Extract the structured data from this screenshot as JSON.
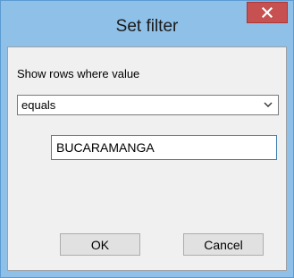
{
  "window": {
    "title": "Set filter",
    "close_icon": "close-x-icon"
  },
  "filter": {
    "prompt": "Show rows where value",
    "operator": {
      "selected": "equals",
      "icon": "chevron-down-icon"
    },
    "value": "BUCARAMANGA"
  },
  "buttons": {
    "ok": "OK",
    "cancel": "Cancel"
  },
  "colors": {
    "titlebar": "#8ec0e8",
    "close_button": "#c75050",
    "client_bg": "#f0f0f0",
    "input_focus_border": "#3c7fb1"
  }
}
